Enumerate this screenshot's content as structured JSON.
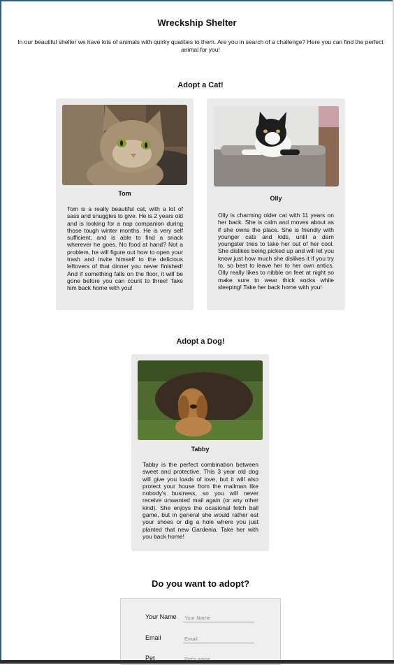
{
  "header": {
    "title": "Wreckship Shelter",
    "intro": "In our beautiful shelter we have lots of animals with quirky qualities to them. Are you in search of a challenge? Here you can find the perfect animal for you!"
  },
  "cats_section": {
    "title": "Adopt a Cat!",
    "animals": [
      {
        "name": "Tom",
        "photo_icon": "tabby-cat-photo",
        "description": "Tom is a really beautiful cat, with a lot of sass and snuggles to give. He is 2 years old and is looking for a nap companion during those tough winter months. He is very self sufficient, and is able to find a snack wherever he goes. No food at hand? Not a problem, he will figure out how to open your trash and invite himself to the delicious leftovers of that dinner you never finished! And if something falls on the floor, it will be gone before you can count to three! Take him back home with you!"
      },
      {
        "name": "Olly",
        "photo_icon": "black-white-cat-photo",
        "description": "Olly is charming older cat with 11 years on her back. She is calm and moves about as if she owns the place. She is friendly with younger cats and kids, until a darn youngster tries to take her out of her cool. She dislikes being picked up and will let you know just how much she dislikes it if you try to, so best to leave her to her own antics. Olly really likes to nibble on feet at night so make sure to wear thick socks while sleeping! Take her back home with you!"
      }
    ]
  },
  "dogs_section": {
    "title": "Adopt a Dog!",
    "animals": [
      {
        "name": "Tabby",
        "photo_icon": "spaniel-dog-photo",
        "description": "Tabby is the perfect combination between sweet and protective. This 3 year old dog will give you loads of love, but it will also protect your house from the mailman like nobody's business, so you will never receive unwanted mail again (or any other kind). She enjoys the ocasional fetch ball game, but in general she would rather eat your shoes or dig a hole where you just planted that new Gardenia. Take her with you back home!"
      }
    ]
  },
  "adopt_form": {
    "title": "Do you want to adopt?",
    "fields": [
      {
        "label": "Your Name",
        "placeholder": "Your Name"
      },
      {
        "label": "Email",
        "placeholder": "Email"
      },
      {
        "label": "Pet",
        "placeholder": "Pet's name"
      }
    ]
  }
}
